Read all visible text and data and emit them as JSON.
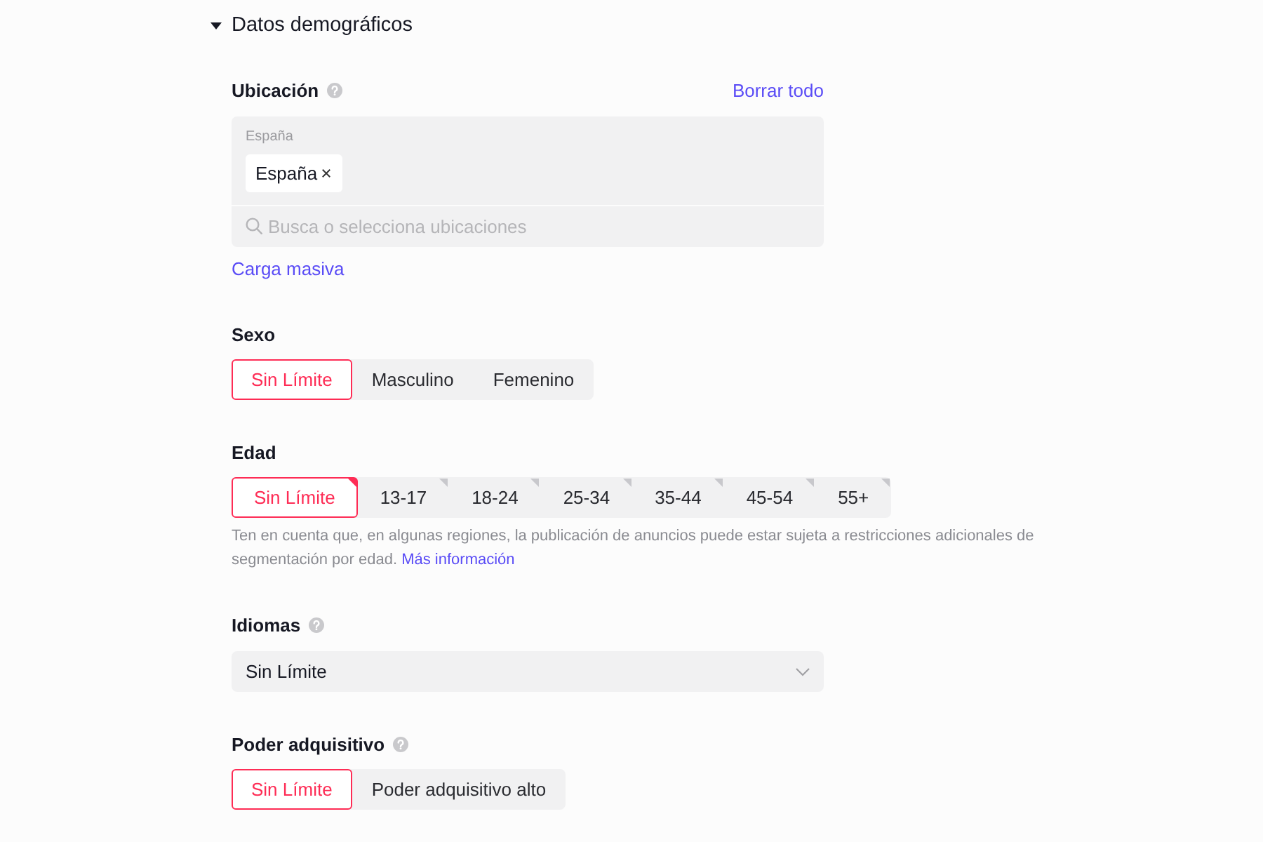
{
  "section": {
    "title": "Datos demográficos",
    "expanded": true
  },
  "fields": [
    {
      "kind": "location",
      "label": "Ubicación",
      "help": true,
      "action": "Borrar todo",
      "group_label": "España",
      "chips": [
        "España"
      ],
      "search": {
        "placeholder": "Busca o selecciona ubicaciones"
      },
      "link": "Carga masiva"
    },
    {
      "kind": "segmented",
      "label": "Sexo",
      "options": [
        {
          "label": "Sin Límite",
          "selected": true
        },
        {
          "label": "Masculino",
          "selected": false
        },
        {
          "label": "Femenino",
          "selected": false
        }
      ]
    },
    {
      "kind": "segmented",
      "label": "Edad",
      "corner_marks": true,
      "options": [
        {
          "label": "Sin Límite",
          "selected": true
        },
        {
          "label": "13-17",
          "selected": false
        },
        {
          "label": "18-24",
          "selected": false
        },
        {
          "label": "25-34",
          "selected": false
        },
        {
          "label": "35-44",
          "selected": false
        },
        {
          "label": "45-54",
          "selected": false
        },
        {
          "label": "55+",
          "selected": false
        }
      ],
      "note": "Ten en cuenta que, en algunas regiones, la publicación de anuncios puede estar sujeta a restricciones adicionales de segmentación por edad.",
      "note_link": "Más información"
    },
    {
      "kind": "dropdown",
      "label": "Idiomas",
      "help": true,
      "value": "Sin Límite"
    },
    {
      "kind": "segmented",
      "label": "Poder adquisitivo",
      "help": true,
      "options": [
        {
          "label": "Sin Límite",
          "selected": true
        },
        {
          "label": "Poder adquisitivo alto",
          "selected": false
        }
      ]
    }
  ]
}
